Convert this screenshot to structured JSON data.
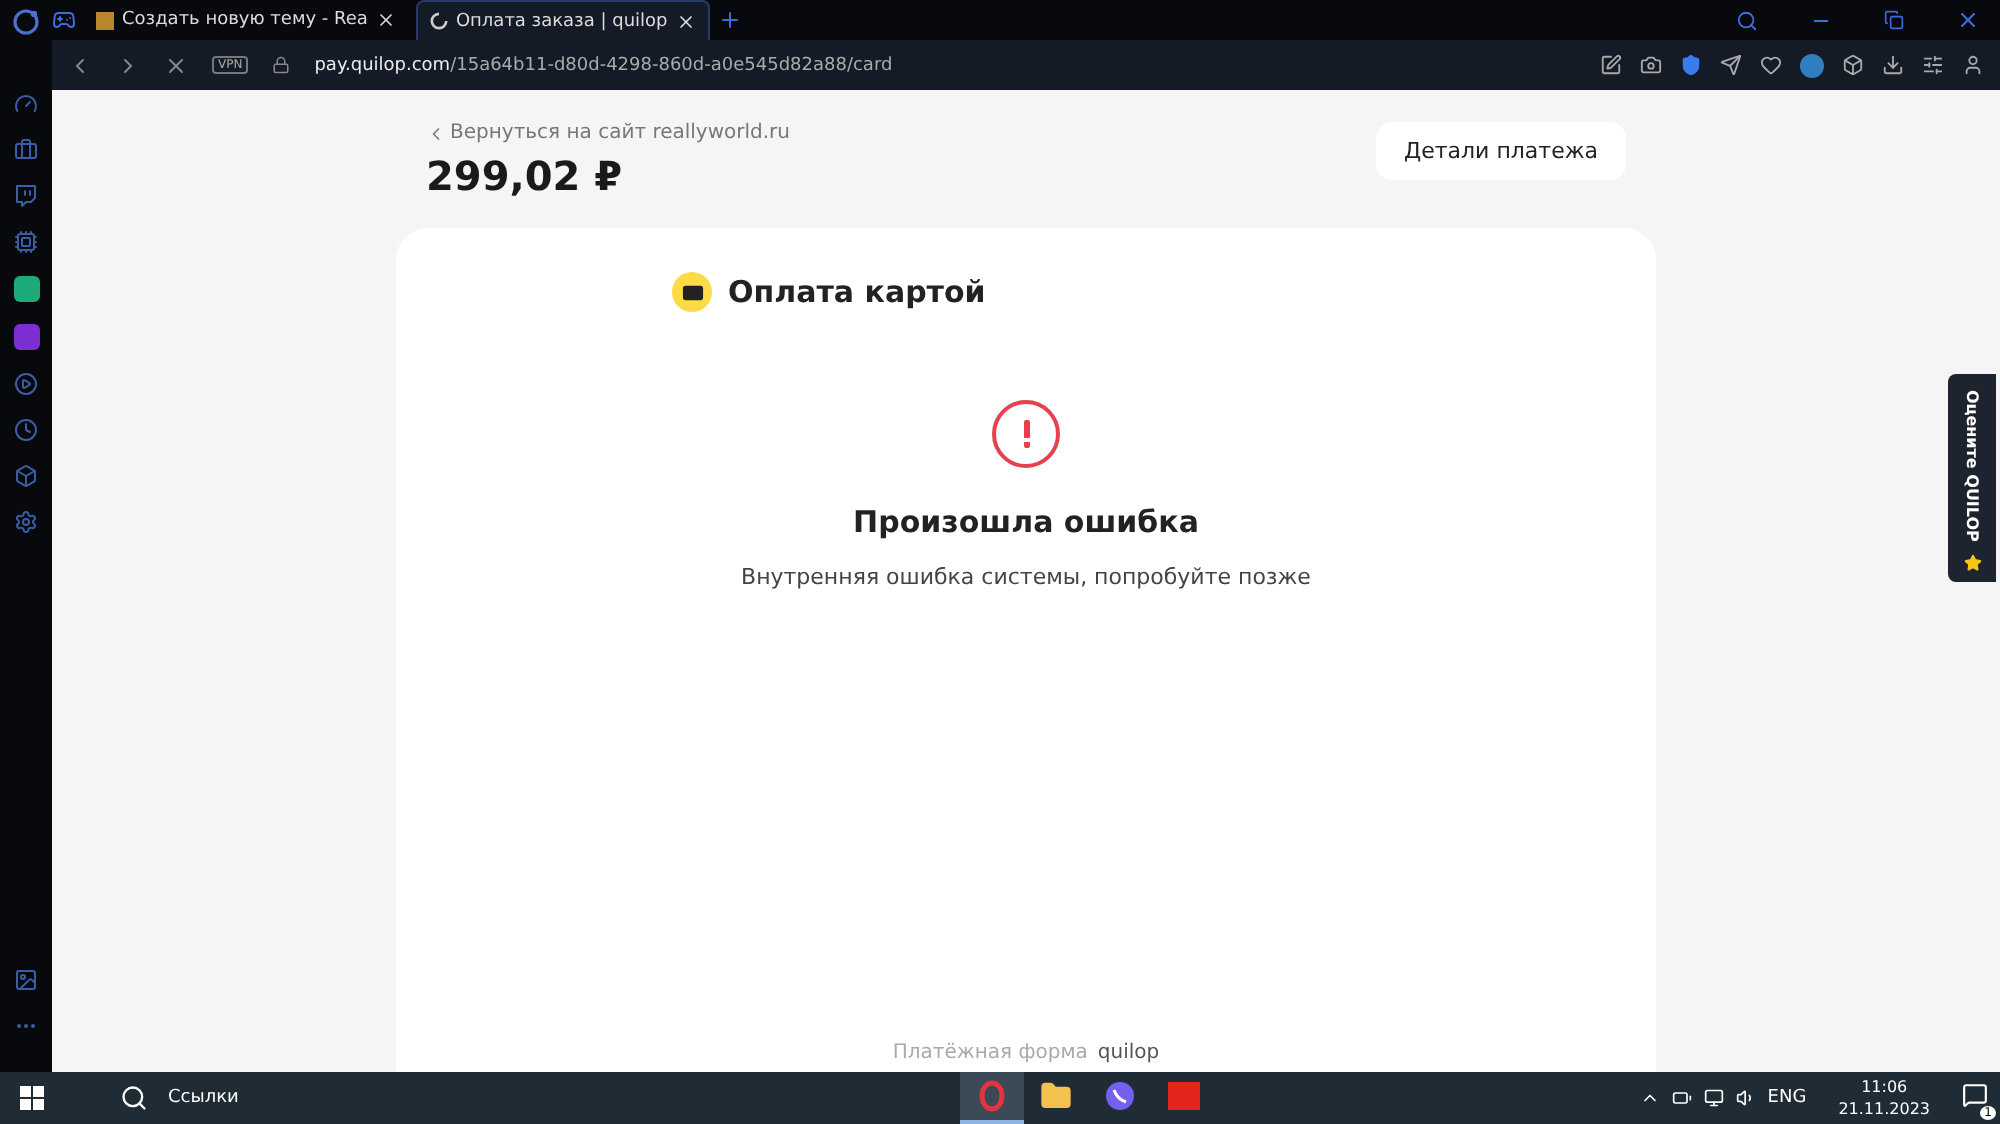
{
  "browser": {
    "tabs": [
      {
        "title": "Создать новую тему - Rea",
        "selected": false,
        "loading": false
      },
      {
        "title": "Оплата заказа | quilop",
        "selected": true,
        "loading": true
      }
    ],
    "vpn_label": "VPN",
    "url_host": "pay.quilop.com",
    "url_path": "/15a64b11-d80d-4298-860d-a0e545d82a88/card"
  },
  "page": {
    "back_link": "Вернуться на сайт reallyworld.ru",
    "amount": "299,02 ₽",
    "details_button": "Детали платежа",
    "method_title": "Оплата картой",
    "error_title": "Произошла ошибка",
    "error_message": "Внутренняя ошибка системы, попробуйте позже",
    "footer_label": "Платёжная форма",
    "footer_brand": "quilop",
    "rate_tab": "Оцените QUILOP"
  },
  "taskbar": {
    "search": "Ссылки",
    "apps": [
      {
        "kind": "opera",
        "selected": true
      },
      {
        "kind": "folder",
        "selected": false
      },
      {
        "kind": "viber",
        "selected": false
      },
      {
        "kind": "kl",
        "selected": false
      }
    ],
    "language": "ENG",
    "time": "11:06",
    "date": "21.11.2023",
    "notifications": "1"
  }
}
